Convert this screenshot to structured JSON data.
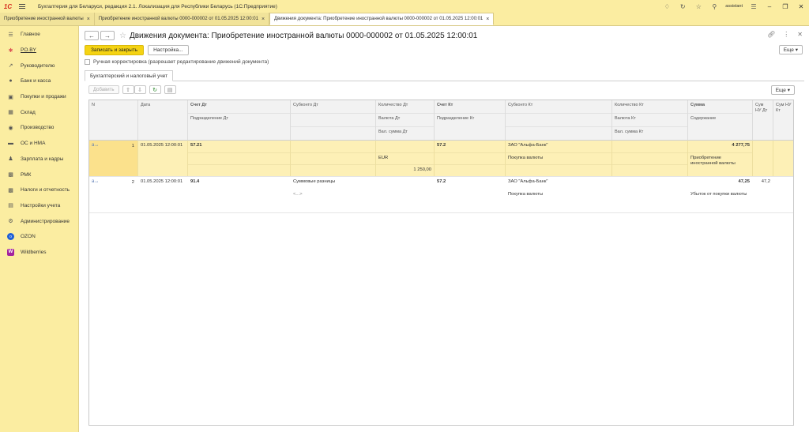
{
  "app": {
    "logo": "1С",
    "title": "Бухгалтерия для Беларуси, редакция 2.1. Локализация для Республики Беларусь  (1С:Предприятие)",
    "user": "assistant"
  },
  "tabs": [
    {
      "label": "Приобретение иностранной валюты"
    },
    {
      "label": "Приобретение иностранной валюты 0000-000002 от 01.05.2025 12:00:01"
    },
    {
      "label": "Движения документа: Приобретение иностранной валюты 0000-000002 от 01.05.2025 12:00:01"
    }
  ],
  "sidebar": {
    "items": [
      {
        "label": "Главное",
        "icon": "menu-icon"
      },
      {
        "label": "PO.BY",
        "icon": "po-by-icon"
      },
      {
        "label": "Руководителю",
        "icon": "chart-line-icon"
      },
      {
        "label": "Банк и касса",
        "icon": "bank-icon"
      },
      {
        "label": "Покупки и продажи",
        "icon": "cart-icon"
      },
      {
        "label": "Склад",
        "icon": "warehouse-icon"
      },
      {
        "label": "Производство",
        "icon": "production-icon"
      },
      {
        "label": "ОС и НМА",
        "icon": "truck-icon"
      },
      {
        "label": "Зарплата и кадры",
        "icon": "person-icon"
      },
      {
        "label": "РМК",
        "icon": "register-icon"
      },
      {
        "label": "Налоги и отчетность",
        "icon": "tax-icon"
      },
      {
        "label": "Настройки учета",
        "icon": "settings-list-icon"
      },
      {
        "label": "Администрирование",
        "icon": "gear-icon"
      },
      {
        "label": "OZON",
        "icon": "ozon-icon"
      },
      {
        "label": "Wildberries",
        "icon": "wildberries-icon"
      }
    ]
  },
  "header": {
    "title": "Движения документа: Приобретение иностранной валюты 0000-000002 от 01.05.2025 12:00:01"
  },
  "toolbar": {
    "save_close": "Записать и закрыть",
    "settings": "Настройка...",
    "more": "Еще"
  },
  "manual_adjustment": {
    "label": "Ручная корректировка (разрешает редактирование движений документа)",
    "checked": false
  },
  "subtab": {
    "label": "Бухгалтерский и налоговый учет"
  },
  "table_toolbar": {
    "add": "Добавить",
    "more": "Еще"
  },
  "table": {
    "headers": {
      "n": "N",
      "date": "Дата",
      "dt_account": "Счет Дт",
      "dt_division": "Подразделение Дт",
      "dt_subconto": "Субконто Дт",
      "dt_qty": "Количество Дт",
      "dt_currency": "Валюта Дт",
      "dt_cur_amount": "Вал. сумма Дт",
      "kt_account": "Счет Кт",
      "kt_division": "Подразделение Кт",
      "kt_subconto": "Субконто Кт",
      "kt_qty": "Количество Кт",
      "kt_currency": "Валюта Кт",
      "kt_cur_amount": "Вал. сумма Кт",
      "amount": "Сумма",
      "content": "Содержание",
      "sum_nu_dt": "Сум НУ Дт",
      "sum_nu_kt": "Сум НУ Кт"
    },
    "rows": [
      {
        "n": "1",
        "date": "01.05.2025 12:00:01",
        "dt_account": "57.21",
        "dt_subconto": "",
        "dt_currency": "EUR",
        "dt_cur_amount": "1 250,00",
        "kt_account": "57.2",
        "kt_subconto1": "ЗАО \"Альфа-Банк\"",
        "kt_subconto2": "Покупка валюты",
        "amount": "4 277,75",
        "content": "Приобретение иностранной валюты",
        "sum_nu_dt": ""
      },
      {
        "n": "2",
        "date": "01.05.2025 12:00:01",
        "dt_account": "91.4",
        "dt_subconto1": "Суммовые разницы",
        "dt_subconto2": "<...>",
        "kt_account": "57.2",
        "kt_subconto1": "ЗАО \"Альфа-Банк\"",
        "kt_subconto2": "Покупка валюты",
        "amount": "47,25",
        "content": "Убыток от покупки валюты",
        "sum_nu_dt": "47,2"
      }
    ]
  }
}
